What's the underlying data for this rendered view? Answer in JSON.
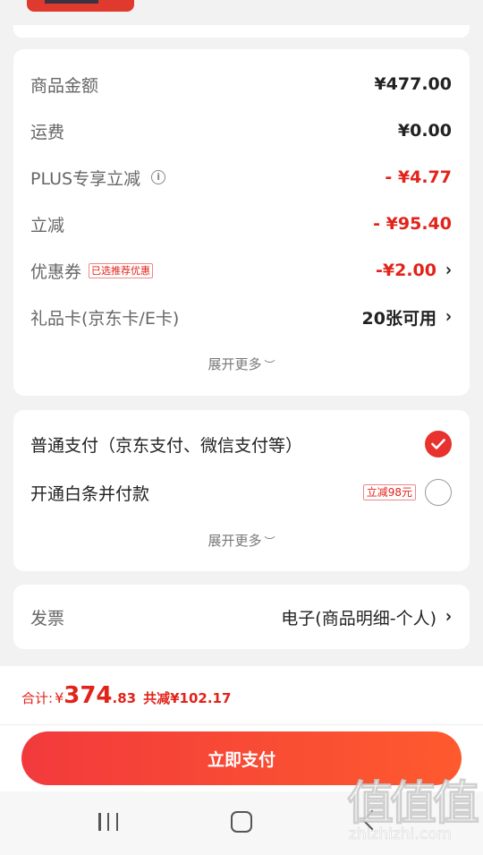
{
  "summary": {
    "goods_amount": {
      "label": "商品金额",
      "value": "¥477.00"
    },
    "shipping": {
      "label": "运费",
      "value": "¥0.00"
    },
    "plus_discount": {
      "label": "PLUS专享立减",
      "value": "- ¥4.77"
    },
    "instant_discount": {
      "label": "立减",
      "value": "- ¥95.40"
    },
    "coupon": {
      "label": "优惠券",
      "tag": "已选推荐优惠",
      "value": "-¥2.00"
    },
    "gift_card": {
      "label": "礼品卡(京东卡/E卡)",
      "value": "20张可用"
    },
    "expand_label": "展开更多"
  },
  "payment": {
    "normal": {
      "label": "普通支付（京东支付、微信支付等）",
      "selected": true
    },
    "baitiao": {
      "label": "开通白条并付款",
      "tag": "立减98元",
      "selected": false
    },
    "expand_label": "展开更多"
  },
  "invoice": {
    "label": "发票",
    "value": "电子(商品明细-个人)"
  },
  "total": {
    "label": "合计:",
    "currency": "¥",
    "integer": "374",
    "decimal": ".83",
    "saved": "共减¥102.17"
  },
  "pay_button": {
    "label": "立即支付"
  },
  "watermark": {
    "chars": "值值值",
    "url": "zhizhizhi.com"
  },
  "colors": {
    "accent": "#e2231a",
    "button_start": "#f23a3c",
    "button_end": "#fe5a2e"
  }
}
